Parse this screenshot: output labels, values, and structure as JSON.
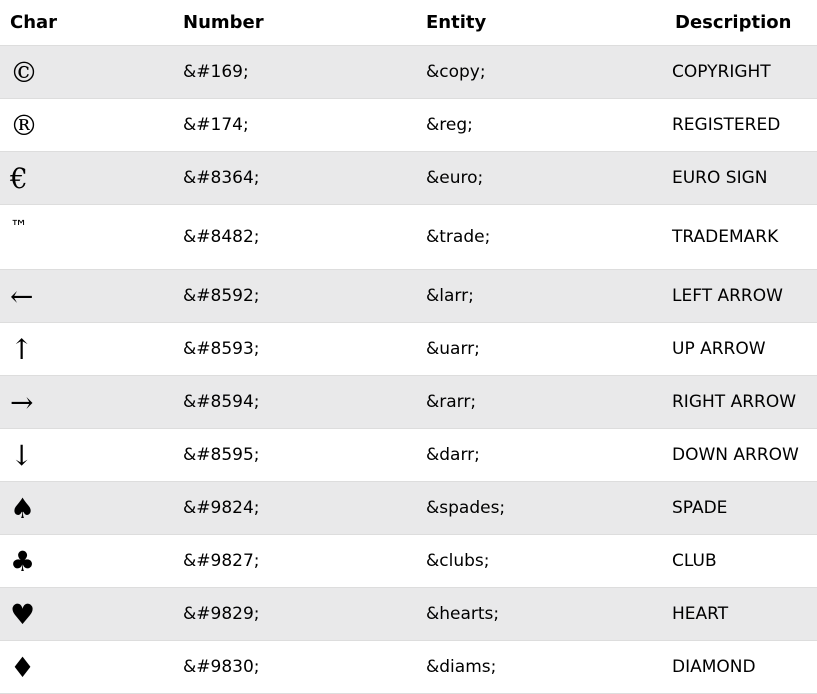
{
  "table": {
    "headers": {
      "char": "Char",
      "number": "Number",
      "entity": "Entity",
      "description": "Description"
    },
    "rows": [
      {
        "char": "©",
        "number": "&#169;",
        "entity": "&copy;",
        "description": "COPYRIGHT"
      },
      {
        "char": "®",
        "number": "&#174;",
        "entity": "&reg;",
        "description": "REGISTERED"
      },
      {
        "char": "€",
        "number": "&#8364;",
        "entity": "&euro;",
        "description": "EURO SIGN"
      },
      {
        "char": "™",
        "number": "&#8482;",
        "entity": "&trade;",
        "description": "TRADEMARK"
      },
      {
        "char": "←",
        "number": "&#8592;",
        "entity": "&larr;",
        "description": "LEFT ARROW"
      },
      {
        "char": "↑",
        "number": "&#8593;",
        "entity": "&uarr;",
        "description": "UP ARROW"
      },
      {
        "char": "→",
        "number": "&#8594;",
        "entity": "&rarr;",
        "description": "RIGHT ARROW"
      },
      {
        "char": "↓",
        "number": "&#8595;",
        "entity": "&darr;",
        "description": "DOWN ARROW"
      },
      {
        "char": "♠",
        "number": "&#9824;",
        "entity": "&spades;",
        "description": "SPADE"
      },
      {
        "char": "♣",
        "number": "&#9827;",
        "entity": "&clubs;",
        "description": "CLUB"
      },
      {
        "char": "♥",
        "number": "&#9829;",
        "entity": "&hearts;",
        "description": "HEART"
      },
      {
        "char": "♦",
        "number": "&#9830;",
        "entity": "&diams;",
        "description": " DIAMOND"
      }
    ]
  },
  "colors": {
    "row_shade": "#e9e9ea",
    "row_border": "#dddddd"
  }
}
